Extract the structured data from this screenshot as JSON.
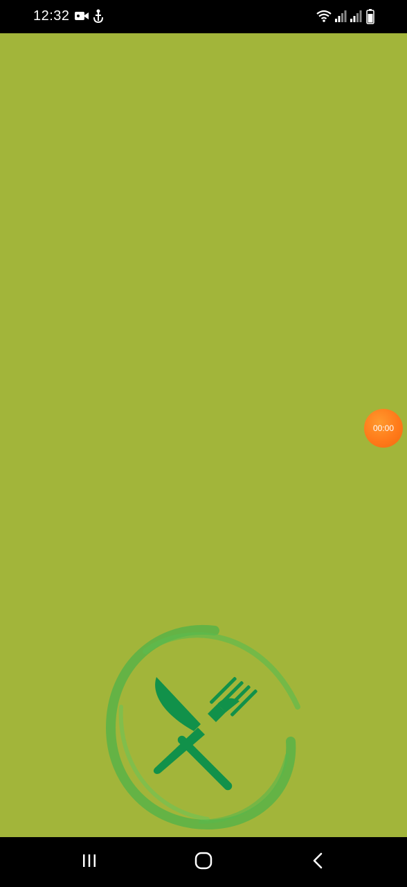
{
  "status_bar": {
    "time": "12:32",
    "icons": [
      "video-camera-icon",
      "usb-anchor-icon",
      "wifi-icon",
      "signal-icon",
      "signal-icon",
      "battery-icon"
    ]
  },
  "app": {
    "background_color": "#a2b53a",
    "logo_icon": "fork-knife-plate-icon",
    "logo_color": "#1e9a4a"
  },
  "timer": {
    "label": "00:00",
    "color": "#ff7a1a"
  },
  "nav_bar": {
    "buttons": [
      "recent-apps-icon",
      "home-icon",
      "back-icon"
    ]
  }
}
